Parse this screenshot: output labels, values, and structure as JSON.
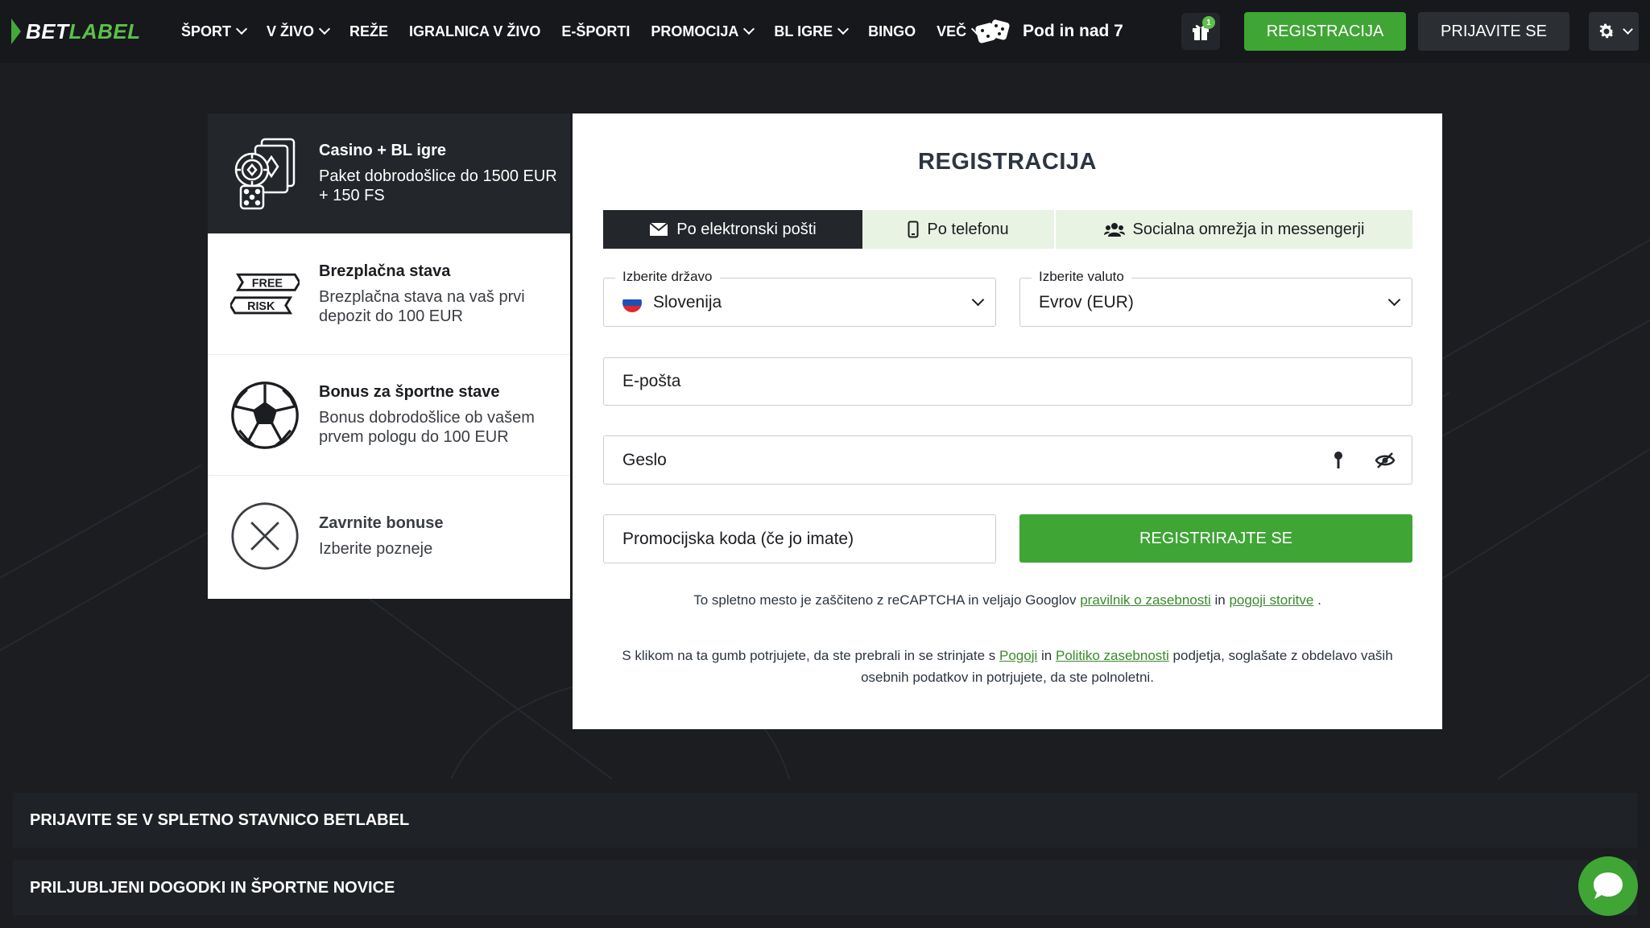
{
  "header": {
    "logo_bet": "BET",
    "logo_label": "LABEL",
    "nav": [
      {
        "label": "ŠPORT",
        "dropdown": true
      },
      {
        "label": "V ŽIVO",
        "dropdown": true
      },
      {
        "label": "REŽE",
        "dropdown": false
      },
      {
        "label": "IGRALNICA V ŽIVO",
        "dropdown": false
      },
      {
        "label": "E-ŠPORTI",
        "dropdown": false
      },
      {
        "label": "PROMOCIJA",
        "dropdown": true
      },
      {
        "label": "BL IGRE",
        "dropdown": true
      },
      {
        "label": "BINGO",
        "dropdown": false
      },
      {
        "label": "VEČ",
        "dropdown": true
      }
    ],
    "game_link": "Pod in nad 7",
    "gift_badge": "1",
    "register_label": "REGISTRACIJA",
    "login_label": "PRIJAVITE SE"
  },
  "bonuses": [
    {
      "title": "Casino + BL igre",
      "desc": "Paket dobrodošlice do 1500 EUR + 150 FS",
      "icon": "casino-chips-icon"
    },
    {
      "title": "Brezplačna stava",
      "desc": "Brezplačna stava na vaš prvi depozit do 100 EUR",
      "icon": "free-risk-icon",
      "icon_text_top": "FREE",
      "icon_text_bottom": "RISK"
    },
    {
      "title": "Bonus za športne stave",
      "desc": "Bonus dobrodošlice ob vašem prvem pologu do 100 EUR",
      "icon": "soccer-ball-icon"
    },
    {
      "title": "Zavrnite bonuse",
      "desc": "Izberite pozneje",
      "icon": "close-circle-icon"
    }
  ],
  "form": {
    "title": "REGISTRACIJA",
    "tabs": [
      "Po elektronski pošti",
      "Po telefonu",
      "Socialna omrežja in messengerji"
    ],
    "country_label": "Izberite državo",
    "country_value": "Slovenija",
    "currency_label": "Izberite valuto",
    "currency_value": "Evrov (EUR)",
    "email_placeholder": "E-pošta",
    "password_placeholder": "Geslo",
    "promo_placeholder": "Promocijska koda (če jo imate)",
    "submit_label": "REGISTRIRAJTE SE",
    "recaptcha_text_1": "To spletno mesto je zaščiteno z reCAPTCHA in veljajo Googlov",
    "recaptcha_link_1": "pravilnik o zasebnosti",
    "recaptcha_and": "in",
    "recaptcha_link_2": "pogoji storitve",
    "recaptcha_end": ".",
    "consent_1": "S klikom na ta gumb potrjujete, da ste prebrali in se strinjate s",
    "consent_link_1": "Pogoji",
    "consent_and": "in",
    "consent_link_2": "Politiko zasebnosti",
    "consent_2": "podjetja, soglašate z obdelavo vaših osebnih podatkov in potrjujete, da ste polnoletni."
  },
  "footer": {
    "accordion_1": "PRIJAVITE SE V SPLETNO STAVNICO BETLABEL",
    "accordion_2": "PRILJUBLJENI DOGODKI IN ŠPORTNE NOVICE"
  },
  "colors": {
    "accent_green": "#3fa535",
    "dark_bg": "#1b1d21",
    "tab_inactive_bg": "#e8f3e3"
  }
}
